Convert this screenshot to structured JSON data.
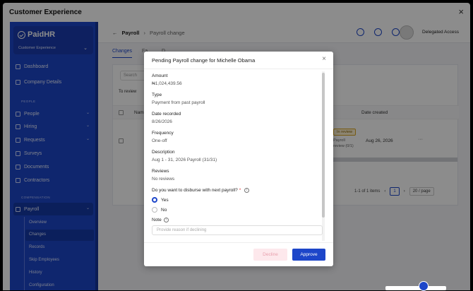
{
  "window": {
    "title": "Customer Experience",
    "close": "×"
  },
  "sidebar": {
    "brand": "PaidHR",
    "brand_sub": "Customer Experience",
    "items": [
      {
        "label": "Dashboard"
      },
      {
        "label": "Company Details"
      }
    ],
    "section_people": "PEOPLE",
    "people_items": [
      {
        "label": "People"
      },
      {
        "label": "Hiring"
      },
      {
        "label": "Requests"
      },
      {
        "label": "Surveys"
      },
      {
        "label": "Documents"
      },
      {
        "label": "Contractors"
      }
    ],
    "section_comp": "COMPENSATION",
    "payroll": "Payroll",
    "payroll_sub": [
      "Overview",
      "Changes",
      "Records",
      "Skip Employees",
      "History",
      "Configuration"
    ]
  },
  "topbar": {
    "back": "←",
    "crumb_parent": "Payroll",
    "crumb_sep": "›",
    "crumb_current": "Payroll change",
    "delegated": "Delegated Access"
  },
  "tabs": [
    "Changes",
    "Fa...",
    "D..."
  ],
  "table": {
    "search_placeholder": "Search",
    "review_btn": "To review",
    "col_name": "Name",
    "col_date": "Date created",
    "status_badge": "In review",
    "status_sub_1": "Payroll",
    "status_sub_2": "review (0/1)",
    "row_date": "Aug 26, 2026",
    "row_dots": "···",
    "pager_text": "1-1 of 1 items",
    "prev": "‹",
    "page": "1",
    "next": "›",
    "per_page": "20 / page"
  },
  "modal": {
    "title": "Pending Payroll change for Michelle Obama",
    "close": "×",
    "fields": [
      {
        "label": "Amount",
        "value": "₦1,024,439.56"
      },
      {
        "label": "Type",
        "value": "Payment from past payroll"
      },
      {
        "label": "Date recorded",
        "value": "8/26/2026"
      },
      {
        "label": "Frequency",
        "value": "One-off"
      },
      {
        "label": "Description",
        "value": "Aug 1 - 31, 2026 Payroll (31/31)"
      },
      {
        "label": "Reviews",
        "value": "No reviews"
      }
    ],
    "question": "Do you want to disburse with next payroll?",
    "required_mark": "*",
    "options": [
      "Yes",
      "No"
    ],
    "selected": "Yes",
    "note_label": "Note",
    "note_placeholder": "Provide reason if declining",
    "decline": "Decline",
    "approve": "Approve"
  },
  "colors": {
    "primary": "#1d46c9",
    "sidebar": "#1d46c9",
    "decline_bg": "#fde8ec"
  }
}
